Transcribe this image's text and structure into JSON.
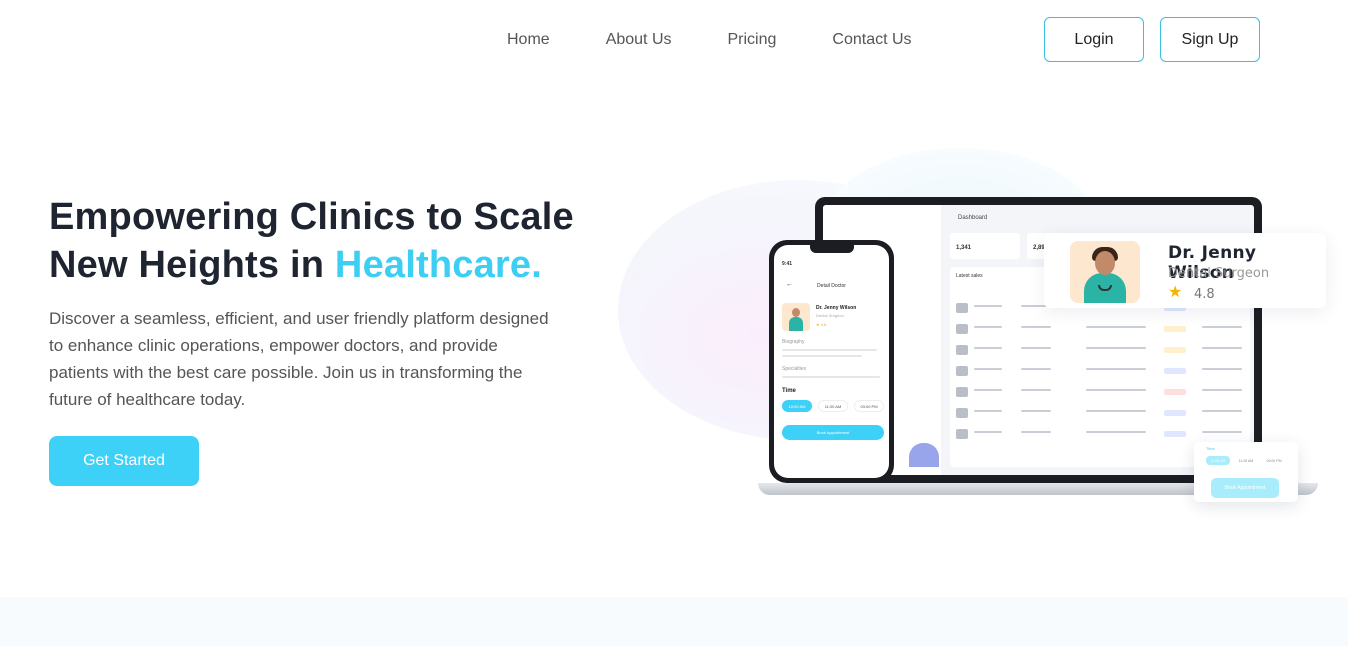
{
  "nav": {
    "links": [
      "Home",
      "About Us",
      "Pricing",
      "Contact Us"
    ],
    "login_label": "Login",
    "signup_label": "Sign Up"
  },
  "hero": {
    "title_part1": "Empowering Clinics to Scale New Heights in ",
    "title_accent": "Healthcare.",
    "description": "Discover a seamless, efficient, and user friendly platform designed to enhance clinic operations, empower doctors, and provide patients with the best care possible. Join us in transforming the future of healthcare today.",
    "cta_label": "Get Started"
  },
  "dashboard": {
    "title": "Dashboard",
    "stats": [
      "1,341",
      "2,89"
    ],
    "table_title": "Latest sales"
  },
  "phone": {
    "time": "9:41",
    "header": "Detail Doctor",
    "doctor_name": "Dr. Jenny Wilson",
    "doctor_sub": "Dental Surgeon",
    "rating": "4.8",
    "biography_label": "Biography",
    "specialties_label": "Specialties",
    "time_label": "Time",
    "chips": [
      "10:00 AM",
      "11:00 AM",
      "03:00 PM"
    ],
    "book_label": "Book Appointment"
  },
  "doctor_card": {
    "name": "Dr. Jenny Wilson",
    "role": "Dental Surgeon",
    "rating": "4.8"
  },
  "time_card": {
    "label": "Time",
    "chips": [
      "10:00 AM",
      "11:00 AM",
      "03:00 PM"
    ],
    "book_label": "Book Appointment"
  },
  "colors": {
    "accent": "#3ccff3",
    "button": "#3dd1f7",
    "border": "#3bbfe0",
    "title": "#1e2530"
  }
}
